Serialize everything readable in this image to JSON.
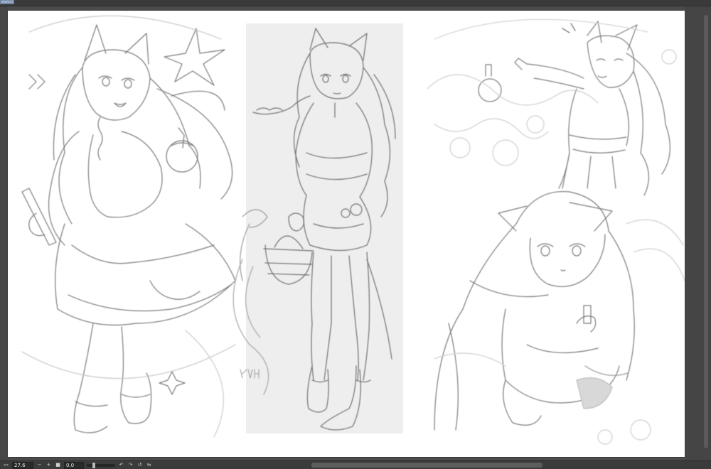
{
  "app": {
    "tab_label": "sketch"
  },
  "statusbar": {
    "zoom_value": "27.6",
    "zoom_out_label": "−",
    "zoom_in_label": "+",
    "fit_icon": "fit-window-icon",
    "angle_value": "0.0",
    "rotate_left_icon": "rotate-left-icon",
    "rotate_right_icon": "rotate-right-icon",
    "reset_icon": "reset-view-icon",
    "flip_icon": "flip-icon"
  },
  "canvas": {
    "signature_text": "KAH"
  },
  "colors": {
    "background": "#4b4b4b",
    "canvas": "#ffffff",
    "sketch": "#8a8a8a",
    "panel_fill": "#eeeeee"
  }
}
